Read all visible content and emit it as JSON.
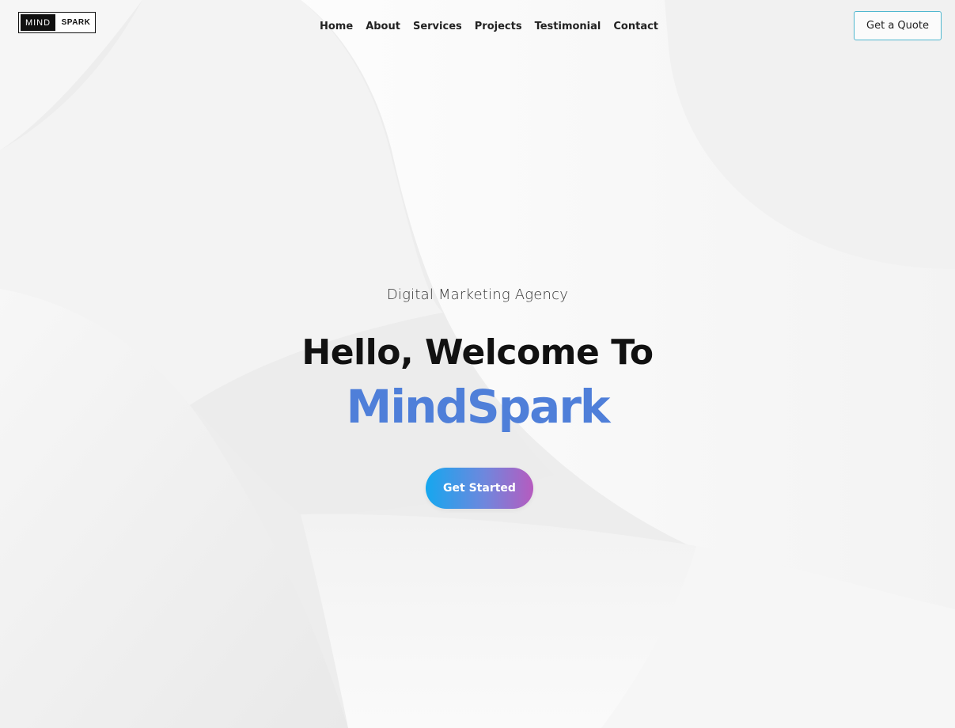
{
  "logo": {
    "left_text": "MIND",
    "right_text": "SPARK"
  },
  "nav": {
    "items": [
      {
        "label": "Home"
      },
      {
        "label": "About"
      },
      {
        "label": "Services"
      },
      {
        "label": "Projects"
      },
      {
        "label": "Testimonial"
      },
      {
        "label": "Contact"
      }
    ]
  },
  "header": {
    "quote_button": "Get a Quote"
  },
  "hero": {
    "subtitle": "Digital Marketing Agency",
    "headline": "Hello, Welcome To",
    "brand": "MindSpark",
    "cta_label": "Get Started"
  },
  "colors": {
    "brand_blue": "#4f7fd9",
    "quote_border": "#4fb7cf",
    "cta_gradient_start": "#15a7ef",
    "cta_gradient_end": "#b65bbf",
    "background": "#efefef"
  }
}
